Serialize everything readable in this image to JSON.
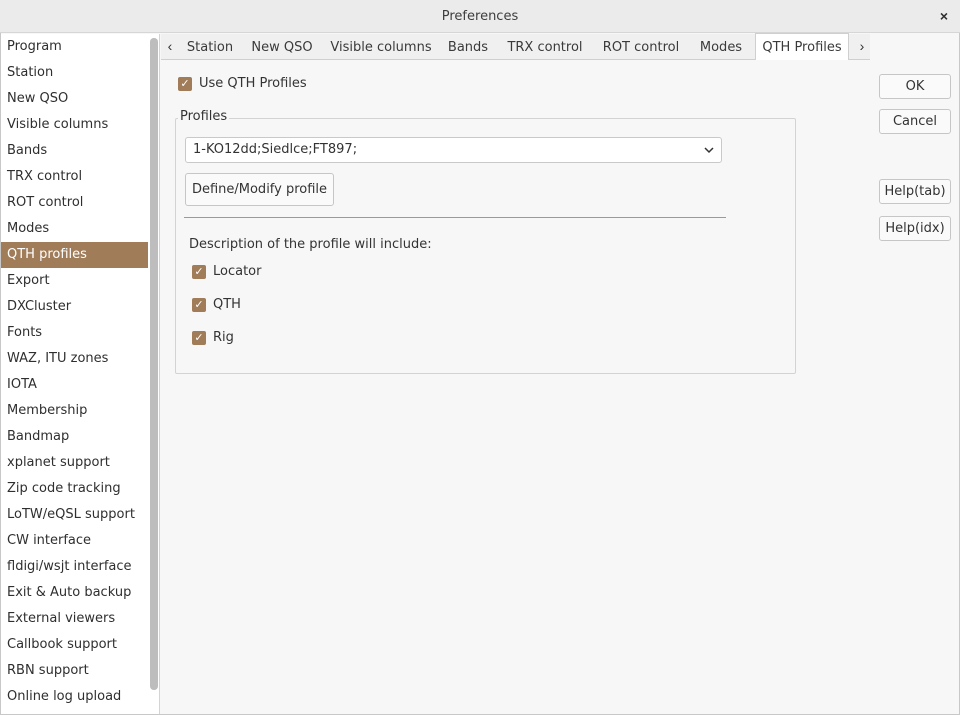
{
  "window": {
    "title": "Preferences",
    "close_glyph": "×"
  },
  "sidebar": {
    "items": [
      {
        "label": "Program"
      },
      {
        "label": "Station"
      },
      {
        "label": "New QSO"
      },
      {
        "label": "Visible columns"
      },
      {
        "label": "Bands"
      },
      {
        "label": "TRX control"
      },
      {
        "label": "ROT control"
      },
      {
        "label": "Modes"
      },
      {
        "label": "QTH profiles",
        "selected": true
      },
      {
        "label": "Export"
      },
      {
        "label": "DXCluster"
      },
      {
        "label": "Fonts"
      },
      {
        "label": "WAZ, ITU zones"
      },
      {
        "label": "IOTA"
      },
      {
        "label": "Membership"
      },
      {
        "label": "Bandmap"
      },
      {
        "label": "xplanet support"
      },
      {
        "label": "Zip code tracking"
      },
      {
        "label": "LoTW/eQSL support"
      },
      {
        "label": "CW interface"
      },
      {
        "label": "fldigi/wsjt interface"
      },
      {
        "label": "Exit & Auto backup"
      },
      {
        "label": "External viewers"
      },
      {
        "label": "Callbook support"
      },
      {
        "label": "RBN support"
      },
      {
        "label": "Online log upload"
      }
    ]
  },
  "tabs": {
    "items": [
      {
        "label": "Station"
      },
      {
        "label": "New QSO"
      },
      {
        "label": "Visible columns"
      },
      {
        "label": "Bands"
      },
      {
        "label": "TRX control"
      },
      {
        "label": "ROT control"
      },
      {
        "label": "Modes"
      },
      {
        "label": "QTH Profiles",
        "active": true
      }
    ],
    "prev_icon": "chevron-left-icon",
    "next_icon": "chevron-right-icon"
  },
  "content": {
    "use_qth_profiles": {
      "label": "Use QTH Profiles",
      "checked": true
    },
    "profiles_group": {
      "title": "Profiles",
      "selected_profile": "1-KO12dd;Siedlce;FT897;",
      "define_button": "Define/Modify profile",
      "description_label": "Description of the profile will include:",
      "options": [
        {
          "label": "Locator",
          "checked": true
        },
        {
          "label": "QTH",
          "checked": true
        },
        {
          "label": "Rig",
          "checked": true
        }
      ]
    }
  },
  "buttons": {
    "ok": "OK",
    "cancel": "Cancel",
    "help_tab": "Help(tab)",
    "help_idx": "Help(idx)"
  },
  "colors": {
    "accent": "#a07c58"
  }
}
